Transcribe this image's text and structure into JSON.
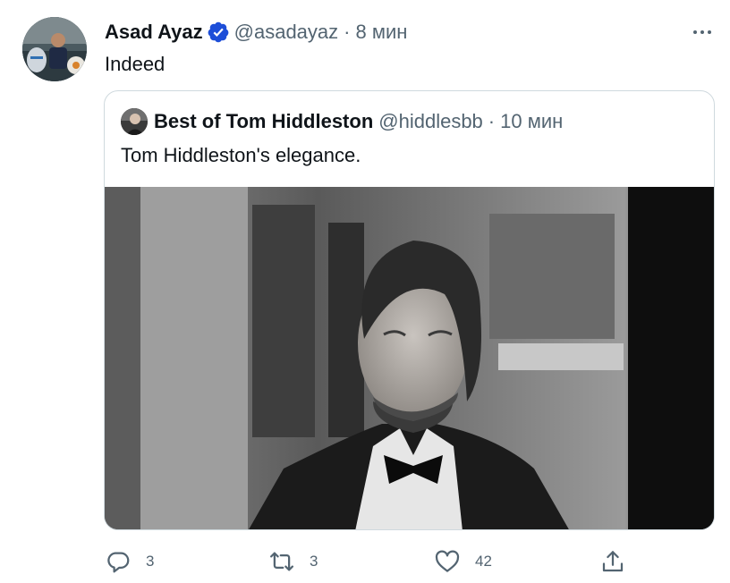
{
  "tweet": {
    "author": {
      "display_name": "Asad Ayaz",
      "handle": "@asadayaz",
      "verified": true,
      "avatar_icon": "avatar-photo"
    },
    "separator": "·",
    "time": "8 мин",
    "text": "Indeed",
    "more_icon": "more-dots-icon"
  },
  "quote": {
    "author": {
      "display_name": "Best of Tom Hiddleston",
      "handle": "@hiddlesbb"
    },
    "separator": "·",
    "time": "10 мин",
    "text": "Tom Hiddleston's elegance.",
    "media": {
      "kind": "black-and-white photo"
    }
  },
  "actions": {
    "reply": {
      "icon": "reply-icon",
      "count": "3"
    },
    "retweet": {
      "icon": "retweet-icon",
      "count": "3"
    },
    "like": {
      "icon": "heart-icon",
      "count": "42"
    },
    "share": {
      "icon": "share-icon"
    }
  },
  "colors": {
    "text_primary": "#0f1419",
    "text_secondary": "#536471",
    "verified_blue": "#1d9bf0",
    "border": "#cfd9de"
  }
}
